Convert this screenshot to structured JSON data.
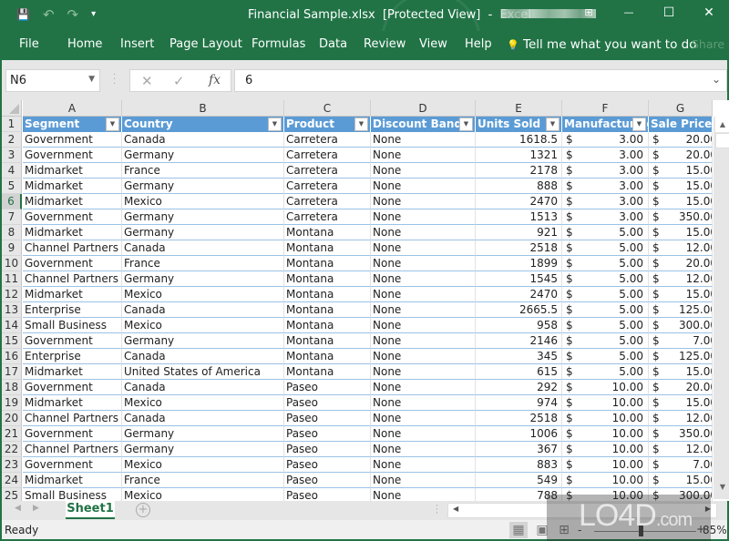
{
  "window": {
    "title": "Financial Sample.xlsx  [Protected View]  -  Excel",
    "controls": {
      "ribbon_display": "⊞",
      "minimize": "—",
      "maximize": "☐",
      "close": "✕"
    }
  },
  "qat": {
    "save": "💾",
    "undo": "↶",
    "redo": "↷",
    "customize": "▾"
  },
  "ribbon": {
    "tabs": [
      "File",
      "Home",
      "Insert",
      "Page Layout",
      "Formulas",
      "Data",
      "Review",
      "View",
      "Help"
    ],
    "tell_me_icon": "💡",
    "tell_me": "Tell me what you want to do",
    "share": "Share"
  },
  "formula_bar": {
    "name_box": "N6",
    "cancel": "✕",
    "enter": "✓",
    "fx": "fx",
    "value": "6",
    "expand": "⌄"
  },
  "sheet": {
    "columns": [
      "A",
      "B",
      "C",
      "D",
      "E",
      "F",
      "G"
    ],
    "headers": [
      "Segment",
      "Country",
      "Product",
      "Discount Band",
      "Units Sold",
      "Manufacturing Price",
      "Sale Price"
    ],
    "selected_row": 6,
    "rows": [
      {
        "n": "2",
        "segment": "Government",
        "country": "Canada",
        "product": "Carretera",
        "discount": "None",
        "units": "1618.5",
        "mfg": "3.00",
        "price": "20.00"
      },
      {
        "n": "3",
        "segment": "Government",
        "country": "Germany",
        "product": "Carretera",
        "discount": "None",
        "units": "1321",
        "mfg": "3.00",
        "price": "20.00"
      },
      {
        "n": "4",
        "segment": "Midmarket",
        "country": "France",
        "product": "Carretera",
        "discount": "None",
        "units": "2178",
        "mfg": "3.00",
        "price": "15.00"
      },
      {
        "n": "5",
        "segment": "Midmarket",
        "country": "Germany",
        "product": "Carretera",
        "discount": "None",
        "units": "888",
        "mfg": "3.00",
        "price": "15.00"
      },
      {
        "n": "6",
        "segment": "Midmarket",
        "country": "Mexico",
        "product": "Carretera",
        "discount": "None",
        "units": "2470",
        "mfg": "3.00",
        "price": "15.00"
      },
      {
        "n": "7",
        "segment": "Government",
        "country": "Germany",
        "product": "Carretera",
        "discount": "None",
        "units": "1513",
        "mfg": "3.00",
        "price": "350.00"
      },
      {
        "n": "8",
        "segment": "Midmarket",
        "country": "Germany",
        "product": "Montana",
        "discount": "None",
        "units": "921",
        "mfg": "5.00",
        "price": "15.00"
      },
      {
        "n": "9",
        "segment": "Channel Partners",
        "country": "Canada",
        "product": "Montana",
        "discount": "None",
        "units": "2518",
        "mfg": "5.00",
        "price": "12.00"
      },
      {
        "n": "10",
        "segment": "Government",
        "country": "France",
        "product": "Montana",
        "discount": "None",
        "units": "1899",
        "mfg": "5.00",
        "price": "20.00"
      },
      {
        "n": "11",
        "segment": "Channel Partners",
        "country": "Germany",
        "product": "Montana",
        "discount": "None",
        "units": "1545",
        "mfg": "5.00",
        "price": "12.00"
      },
      {
        "n": "12",
        "segment": "Midmarket",
        "country": "Mexico",
        "product": "Montana",
        "discount": "None",
        "units": "2470",
        "mfg": "5.00",
        "price": "15.00"
      },
      {
        "n": "13",
        "segment": "Enterprise",
        "country": "Canada",
        "product": "Montana",
        "discount": "None",
        "units": "2665.5",
        "mfg": "5.00",
        "price": "125.00"
      },
      {
        "n": "14",
        "segment": "Small Business",
        "country": "Mexico",
        "product": "Montana",
        "discount": "None",
        "units": "958",
        "mfg": "5.00",
        "price": "300.00"
      },
      {
        "n": "15",
        "segment": "Government",
        "country": "Germany",
        "product": "Montana",
        "discount": "None",
        "units": "2146",
        "mfg": "5.00",
        "price": "7.00"
      },
      {
        "n": "16",
        "segment": "Enterprise",
        "country": "Canada",
        "product": "Montana",
        "discount": "None",
        "units": "345",
        "mfg": "5.00",
        "price": "125.00"
      },
      {
        "n": "17",
        "segment": "Midmarket",
        "country": "United States of America",
        "product": "Montana",
        "discount": "None",
        "units": "615",
        "mfg": "5.00",
        "price": "15.00"
      },
      {
        "n": "18",
        "segment": "Government",
        "country": "Canada",
        "product": "Paseo",
        "discount": "None",
        "units": "292",
        "mfg": "10.00",
        "price": "20.00"
      },
      {
        "n": "19",
        "segment": "Midmarket",
        "country": "Mexico",
        "product": "Paseo",
        "discount": "None",
        "units": "974",
        "mfg": "10.00",
        "price": "15.00"
      },
      {
        "n": "20",
        "segment": "Channel Partners",
        "country": "Canada",
        "product": "Paseo",
        "discount": "None",
        "units": "2518",
        "mfg": "10.00",
        "price": "12.00"
      },
      {
        "n": "21",
        "segment": "Government",
        "country": "Germany",
        "product": "Paseo",
        "discount": "None",
        "units": "1006",
        "mfg": "10.00",
        "price": "350.00"
      },
      {
        "n": "22",
        "segment": "Channel Partners",
        "country": "Germany",
        "product": "Paseo",
        "discount": "None",
        "units": "367",
        "mfg": "10.00",
        "price": "12.00"
      },
      {
        "n": "23",
        "segment": "Government",
        "country": "Mexico",
        "product": "Paseo",
        "discount": "None",
        "units": "883",
        "mfg": "10.00",
        "price": "7.00"
      },
      {
        "n": "24",
        "segment": "Midmarket",
        "country": "France",
        "product": "Paseo",
        "discount": "None",
        "units": "549",
        "mfg": "10.00",
        "price": "15.00"
      },
      {
        "n": "25",
        "segment": "Small Business",
        "country": "Mexico",
        "product": "Paseo",
        "discount": "None",
        "units": "788",
        "mfg": "10.00",
        "price": "300.00"
      }
    ],
    "currency_symbol": "$",
    "filter_glyph": "▼"
  },
  "sheet_tabs": {
    "prev": "◀",
    "next": "▶",
    "active": "Sheet1",
    "add": "+"
  },
  "status": {
    "ready": "Ready",
    "view_normal": "▦",
    "view_page_layout": "▣",
    "view_page_break": "⊞",
    "zoom_minus": "-",
    "zoom_plus": "+",
    "zoom_percent": "85%",
    "zoom_level": 0.85
  },
  "watermark": {
    "text": "LO4D",
    "suffix": ".com"
  }
}
